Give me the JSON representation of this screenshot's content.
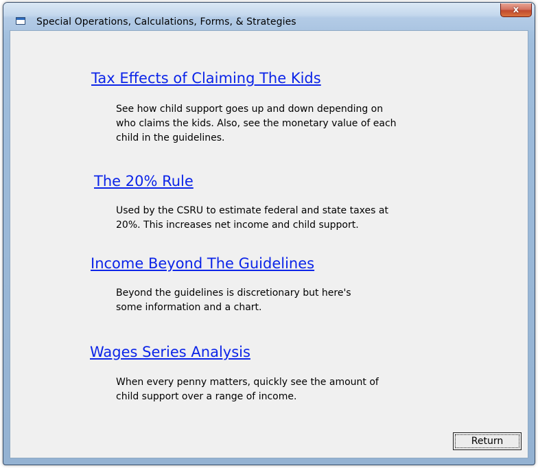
{
  "window": {
    "title": "Special Operations, Calculations, Forms, & Strategies",
    "close_label": "x"
  },
  "sections": [
    {
      "link": "Tax Effects of Claiming The Kids",
      "description": "See how child support goes up and down depending on\nwho claims the kids. Also, see the monetary value of each\nchild in the guidelines."
    },
    {
      "link": "The 20% Rule",
      "description": "Used by the CSRU to estimate federal and state taxes at\n20%.  This increases net income and child support."
    },
    {
      "link": "Income Beyond The Guidelines",
      "description": "Beyond the guidelines is discretionary but here's\nsome information and a chart."
    },
    {
      "link": "Wages Series Analysis",
      "description": "When every penny matters, quickly see the amount of\nchild support over a range of income."
    }
  ],
  "footer": {
    "return_label": "Return"
  },
  "colors": {
    "link": "#0b24e8",
    "client_background": "#f0f0f0",
    "close_button": "#c14a2f"
  },
  "icons": {
    "title_icon": "window-icon",
    "close_icon": "close-icon"
  }
}
